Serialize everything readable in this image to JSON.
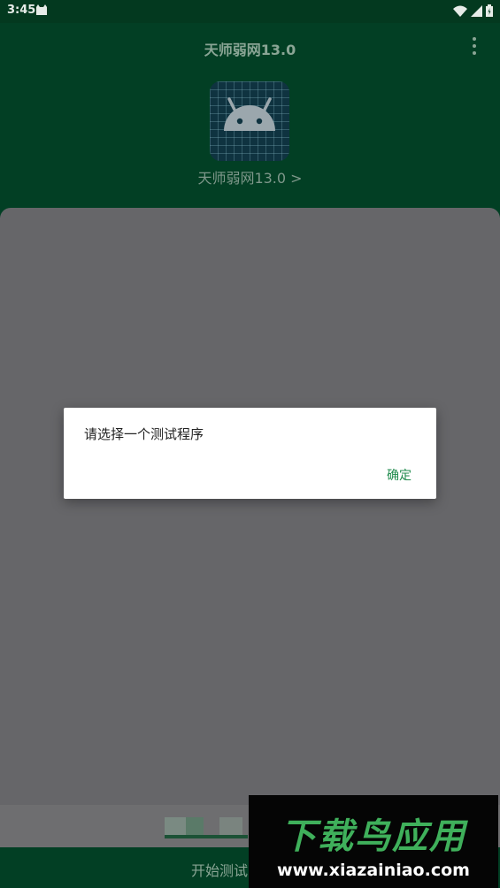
{
  "status_bar": {
    "time": "3:45",
    "icons": [
      "cat-icon",
      "wifi-icon",
      "signal-icon",
      "battery-icon"
    ]
  },
  "header": {
    "title": "天师弱网13.0",
    "menu_icon": "overflow-menu-icon",
    "app_icon": "android-icon",
    "app_name_link": "天师弱网13.0 >"
  },
  "bottom_bar": {
    "start_label": "开始测试"
  },
  "dialog": {
    "message": "请选择一个测试程序",
    "ok_label": "确定"
  },
  "watermark": {
    "title": "下载鸟应用",
    "url": "www.xiazainiao.com"
  },
  "colors": {
    "primary_dark": "#023f24",
    "accent": "#1f8a4c",
    "scrim": "#666669"
  }
}
